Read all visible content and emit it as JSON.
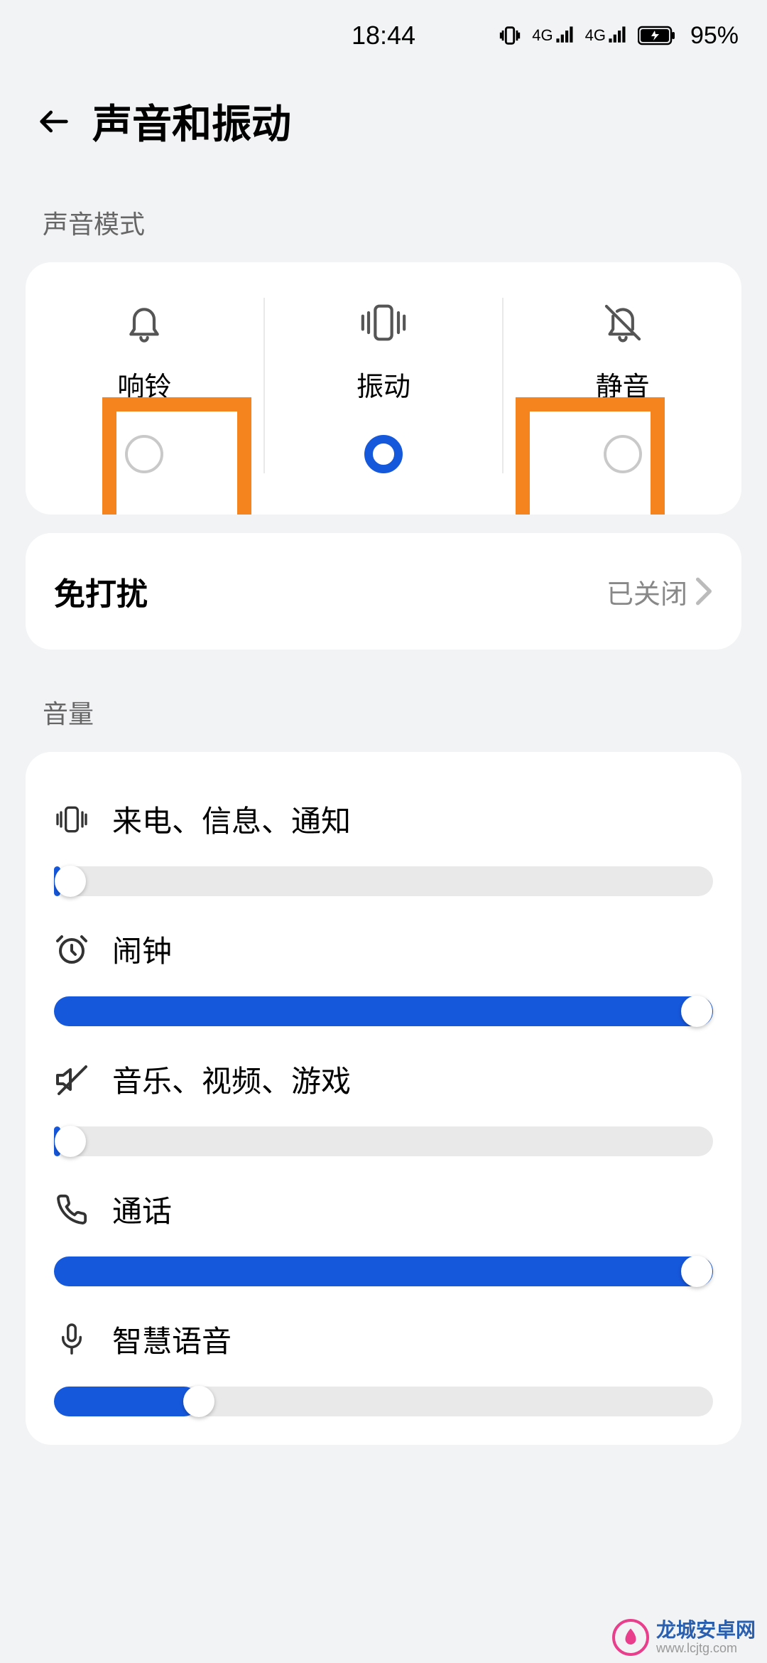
{
  "status": {
    "time": "18:44",
    "battery": "95%"
  },
  "header": {
    "title": "声音和振动"
  },
  "sections": {
    "mode_label": "声音模式",
    "volume_label": "音量"
  },
  "modes": [
    {
      "label": "响铃",
      "selected": false,
      "highlight": true
    },
    {
      "label": "振动",
      "selected": true,
      "highlight": false
    },
    {
      "label": "静音",
      "selected": false,
      "highlight": true
    }
  ],
  "dnd": {
    "title": "免打扰",
    "value": "已关闭"
  },
  "volumes": [
    {
      "label": "来电、信息、通知",
      "percent": 1
    },
    {
      "label": "闹钟",
      "percent": 100
    },
    {
      "label": "音乐、视频、游戏",
      "percent": 1
    },
    {
      "label": "通话",
      "percent": 100
    },
    {
      "label": "智慧语音",
      "percent": 22
    }
  ],
  "watermark": {
    "main": "龙城安卓网",
    "sub": "www.lcjtg.com"
  }
}
